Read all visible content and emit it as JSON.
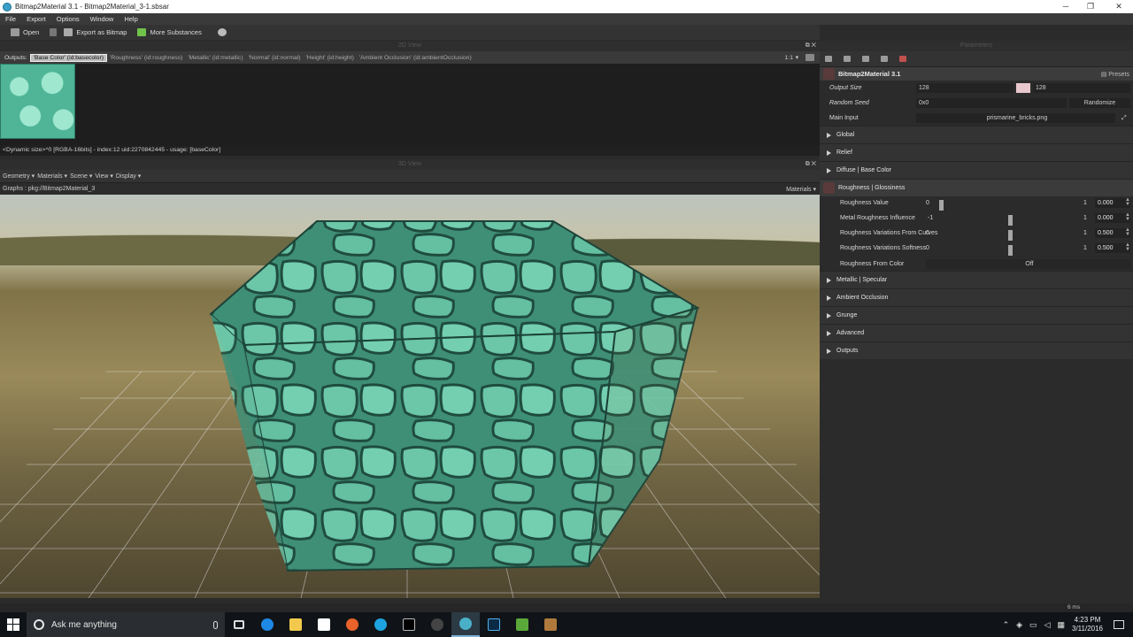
{
  "window": {
    "title": "Bitmap2Material 3.1 - Bitmap2Material_3-1.sbsar",
    "minimize": "─",
    "maximize": "❐",
    "close": "✕"
  },
  "menu": [
    "File",
    "Export",
    "Options",
    "Window",
    "Help"
  ],
  "toolbar": {
    "open": "Open",
    "export": "Export as Bitmap",
    "more": "More Substances"
  },
  "view2d": {
    "title": "2D View",
    "outputs_label": "Outputs:",
    "outputs": [
      "'Base Color' (id:basecolor)",
      "'Roughness' (id:roughness)",
      "'Metallic' (id:metallic)",
      "'Normal' (id:normal)",
      "'Height' (id:height)",
      "'Ambient Occlusion' (id:ambientOcclusion)"
    ],
    "zoom": "1:1",
    "info": "<Dynamic size>^0 [RGBA-16bits] - index:12 uid:2270842445 - usage: [baseColor]"
  },
  "view3d": {
    "title": "3D View",
    "menus": [
      "Geometry ▾",
      "Materials ▾",
      "Scene ▾",
      "View ▾",
      "Display ▾"
    ],
    "graphs_label": "Graphs :  pkg://Bitmap2Material_3",
    "materials": "Materials ▾"
  },
  "params": {
    "title": "Parameters",
    "header": "Bitmap2Material 3.1",
    "presets": "Presets",
    "output_size_label": "Output Size",
    "output_size_w": "128",
    "output_size_h": "128",
    "random_seed_label": "Random Seed",
    "random_seed_value": "0x0",
    "randomize": "Randomize",
    "main_input_label": "Main Input",
    "main_input_value": "prismarine_bricks.png",
    "sections_top": [
      "Global",
      "Relief",
      "Diffuse | Base Color"
    ],
    "open_section": "Roughness | Glossiness",
    "sliders": [
      {
        "label": "Roughness Value",
        "min": "0",
        "max": "1",
        "value": "0.000",
        "frac": 0.0
      },
      {
        "label": "Metal Roughness Influence",
        "min": "-1",
        "max": "1",
        "value": "0.000",
        "frac": 0.5
      },
      {
        "label": "Roughness Variations From Curves",
        "min": "0",
        "max": "1",
        "value": "0.500",
        "frac": 0.5
      },
      {
        "label": "Roughness Variations Softness",
        "min": "0",
        "max": "1",
        "value": "0.500",
        "frac": 0.5
      }
    ],
    "rough_from_color_label": "Roughness From Color",
    "rough_from_color_value": "Off",
    "sections_bottom": [
      "Metallic | Specular",
      "Ambient Occlusion",
      "Grunge",
      "Advanced",
      "Outputs"
    ]
  },
  "status": {
    "ms": "6 ms"
  },
  "taskbar": {
    "search": "Ask me anything",
    "time": "4:23 PM",
    "date": "3/11/2016",
    "apps": [
      "task-view",
      "edge",
      "file-explorer",
      "store",
      "firefox",
      "skype",
      "cmd",
      "substance-designer",
      "bitmap2material",
      "photoshop",
      "minecraft",
      "package"
    ]
  }
}
